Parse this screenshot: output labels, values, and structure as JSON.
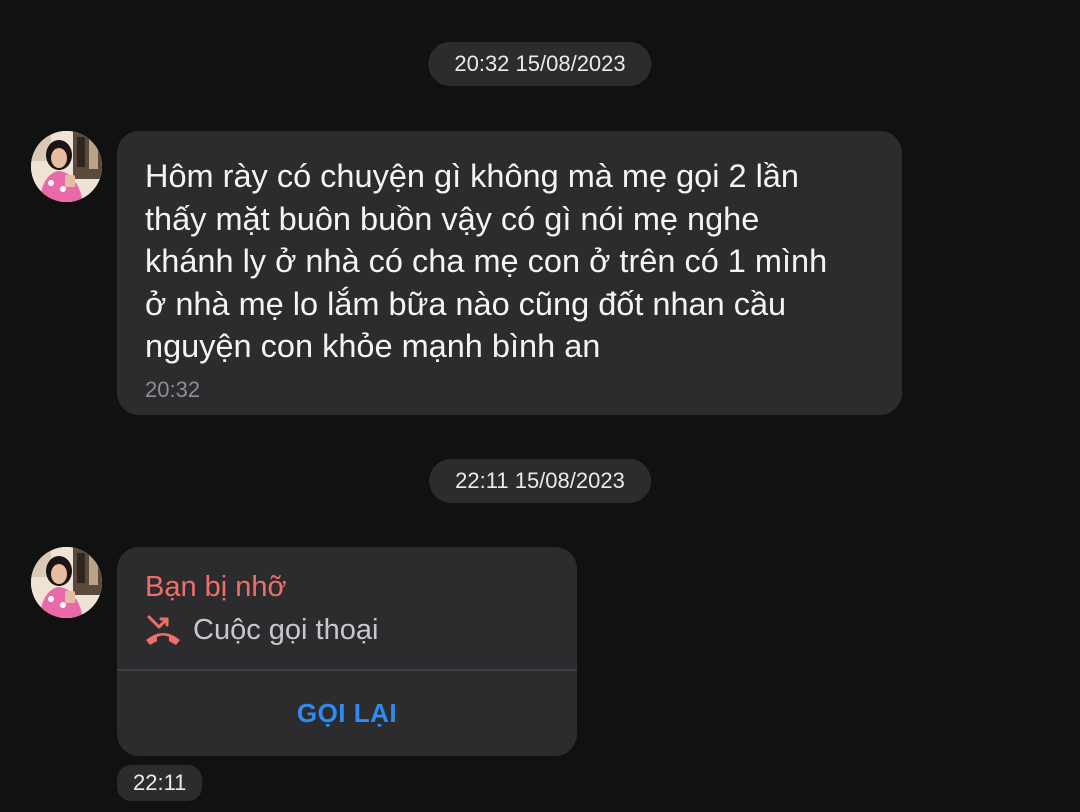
{
  "conversation": {
    "dividers": [
      "20:32 15/08/2023",
      "22:11 15/08/2023"
    ],
    "messages": [
      {
        "type": "text",
        "text": "Hôm rày có chuyện gì không mà mẹ gọi 2 lần\nthấy mặt buôn buồn vậy có gì nói mẹ nghe\nkhánh ly ở nhà có cha mẹ con ở trên có 1 mình\nở nhà mẹ lo lắm bữa nào cũng đốt nhan cầu\nnguyện con khỏe mạnh bình an",
        "time": "20:32"
      },
      {
        "type": "missed-call",
        "title": "Bạn bị nhỡ",
        "label": "Cuộc gọi thoại",
        "action": "GỌI LẠI",
        "time": "22:11"
      }
    ]
  },
  "colors": {
    "background": "#111112",
    "bubble": "#2c2c2e",
    "missed": "#ee6f6a",
    "action": "#2e8cf0"
  },
  "icons": {
    "missed_call": "missed-call-icon",
    "avatar": "contact-avatar"
  }
}
